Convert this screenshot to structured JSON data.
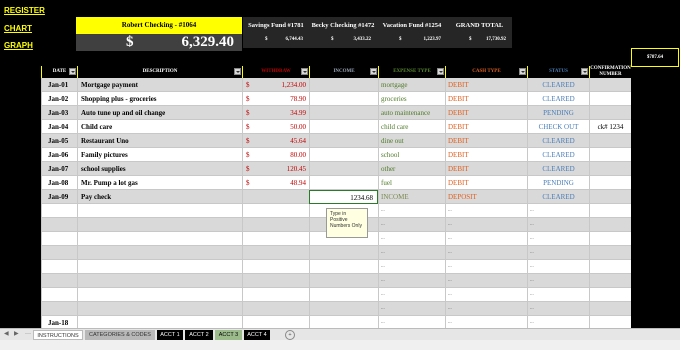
{
  "nav": {
    "register": "REGISTER",
    "chart": "CHART",
    "graph": "GRAPH"
  },
  "account": {
    "title": "Robert Checking - #1064",
    "currency": "$",
    "balance": "6,329.40"
  },
  "summary": [
    {
      "label": "Savings Fund #1781",
      "dollar": "$",
      "value": "6,744.43"
    },
    {
      "label": "Becky Checking #1472",
      "dollar": "$",
      "value": "3,433.22"
    },
    {
      "label": "Vacation Fund #1254",
      "dollar": "$",
      "value": "1,223.97"
    },
    {
      "label": "GRAND TOTAL",
      "dollar": "$",
      "value": "17,730.92"
    }
  ],
  "side_value": "$787.64",
  "columns": {
    "date": "DATE",
    "description": "DESCRIPTION",
    "withdraw": "WITHDRAW",
    "income": "INCOME",
    "expense_type": "EXPENSE TYPE",
    "cash_type": "CASH TYPE",
    "status": "STATUS",
    "confirmation": "CONFIRMATION NUMBER"
  },
  "rows": [
    {
      "date": "Jan-01",
      "desc": "Mortgage payment",
      "dollar": "$",
      "withdraw": "1,234.00",
      "income": "",
      "expense": "mortgage",
      "cash": "DEBIT",
      "status": "CLEARED",
      "conf": ""
    },
    {
      "date": "Jan-02",
      "desc": "Shopping plus - groceries",
      "dollar": "$",
      "withdraw": "78.90",
      "income": "",
      "expense": "groceries",
      "cash": "DEBIT",
      "status": "CLEARED",
      "conf": ""
    },
    {
      "date": "Jan-03",
      "desc": "Auto tune up and oil change",
      "dollar": "$",
      "withdraw": "34.99",
      "income": "",
      "expense": "auto maintenance",
      "cash": "DEBIT",
      "status": "PENDING",
      "conf": ""
    },
    {
      "date": "Jan-04",
      "desc": "Child care",
      "dollar": "$",
      "withdraw": "50.00",
      "income": "",
      "expense": "child care",
      "cash": "DEBIT",
      "status": "CHECK OUT",
      "conf": "ck# 1234"
    },
    {
      "date": "Jan-05",
      "desc": "Restaurant Uno",
      "dollar": "$",
      "withdraw": "45.64",
      "income": "",
      "expense": "dine out",
      "cash": "DEBIT",
      "status": "CLEARED",
      "conf": ""
    },
    {
      "date": "Jan-06",
      "desc": "Family pictures",
      "dollar": "$",
      "withdraw": "80.00",
      "income": "",
      "expense": "school",
      "cash": "DEBIT",
      "status": "CLEARED",
      "conf": ""
    },
    {
      "date": "Jan-07",
      "desc": "school supplies",
      "dollar": "$",
      "withdraw": "120.45",
      "income": "",
      "expense": "other",
      "cash": "DEBIT",
      "status": "CLEARED",
      "conf": ""
    },
    {
      "date": "Jan-08",
      "desc": "Mr. Pump a lot gas",
      "dollar": "$",
      "withdraw": "48.94",
      "income": "",
      "expense": "fuel",
      "cash": "DEBIT",
      "status": "PENDING",
      "conf": ""
    },
    {
      "date": "Jan-09",
      "desc": "Pay check",
      "dollar": "",
      "withdraw": "",
      "income": "1234.68",
      "expense": "INCOME",
      "cash": "DEPOSIT",
      "status": "CLEARED",
      "conf": ""
    }
  ],
  "empty_placeholder": "...",
  "last_date": "Jan-18",
  "tooltip": "Type in Positive Numbers Only",
  "tabs": [
    "INSTRUCTIONS",
    "CATEGORIES & CODES",
    "ACCT 1",
    "ACCT 2",
    "ACCT 3",
    "ACCT 4"
  ],
  "add_sheet": "+"
}
